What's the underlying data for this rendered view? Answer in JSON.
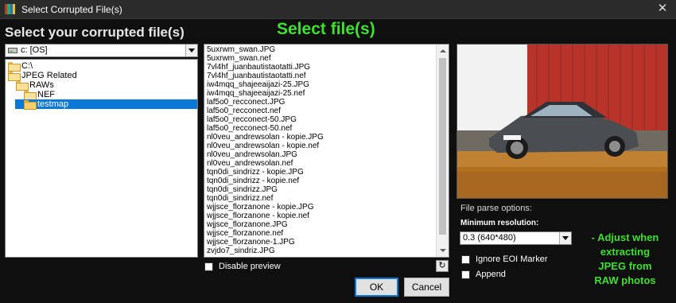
{
  "window": {
    "title": "Select Corrupted File(s)",
    "close_glyph": "✕",
    "icon": "app-icon",
    "icon_colors": [
      "#c0392b",
      "#27ae60",
      "#2e6bd6",
      "#f1c40f"
    ]
  },
  "left": {
    "heading": "Select your corrupted file(s)",
    "drive": {
      "value": "c: [OS]",
      "icon": "drive-icon"
    },
    "tree": [
      {
        "label": "C:\\",
        "depth": 0,
        "selected": false
      },
      {
        "label": "JPEG Related",
        "depth": 0,
        "selected": false
      },
      {
        "label": "RAWs",
        "depth": 1,
        "selected": false
      },
      {
        "label": "NEF",
        "depth": 2,
        "selected": false
      },
      {
        "label": "testmap",
        "depth": 2,
        "selected": true
      }
    ]
  },
  "annotations": {
    "select_files": "Select file(s)",
    "adjust_lines": [
      "- Adjust when",
      "extracting",
      "JPEG from",
      "RAW photos"
    ]
  },
  "files": [
    "5uxrwm_swan.JPG",
    "5uxrwm_swan.nef",
    "7vl4hf_juanbautistaotatti.JPG",
    "7vl4hf_juanbautistaotatti.nef",
    "iw4mqq_shajeeaijazi-25.JPG",
    "iw4mqq_shajeeaijazi-25.nef",
    "laf5o0_recconect.JPG",
    "laf5o0_recconect.nef",
    "laf5o0_recconect-50.JPG",
    "laf5o0_recconect-50.nef",
    "nl0veu_andrewsolan - kopie.JPG",
    "nl0veu_andrewsolan - kopie.nef",
    "nl0veu_andrewsolan.JPG",
    "nl0veu_andrewsolan.nef",
    "tqn0di_sindrizz - kopie.JPG",
    "tqn0di_sindrizz - kopie.nef",
    "tqn0di_sindrizz.JPG",
    "tqn0di_sindrizz.nef",
    "wjjsce_florzanone - kopie.JPG",
    "wjjsce_florzanone - kopie.nef",
    "wjjsce_florzanone.JPG",
    "wjjsce_florzanone.nef",
    "wjjsce_florzanone-1.JPG",
    "zvjdo7_sindriz.JPG"
  ],
  "options": {
    "disable_preview": "Disable preview",
    "refresh_glyph": "↻",
    "parse_title": "File parse options:",
    "min_res_label": "Minimum resolution:",
    "min_res_value": "0.3 (640*480)",
    "ignore_eoi": "Ignore EOI Marker",
    "append": "Append"
  },
  "buttons": {
    "ok": "OK",
    "cancel": "Cancel"
  },
  "colors": {
    "accent": "#0a78d7",
    "annotation": "#3fe030",
    "background": "#0f0f0f"
  }
}
